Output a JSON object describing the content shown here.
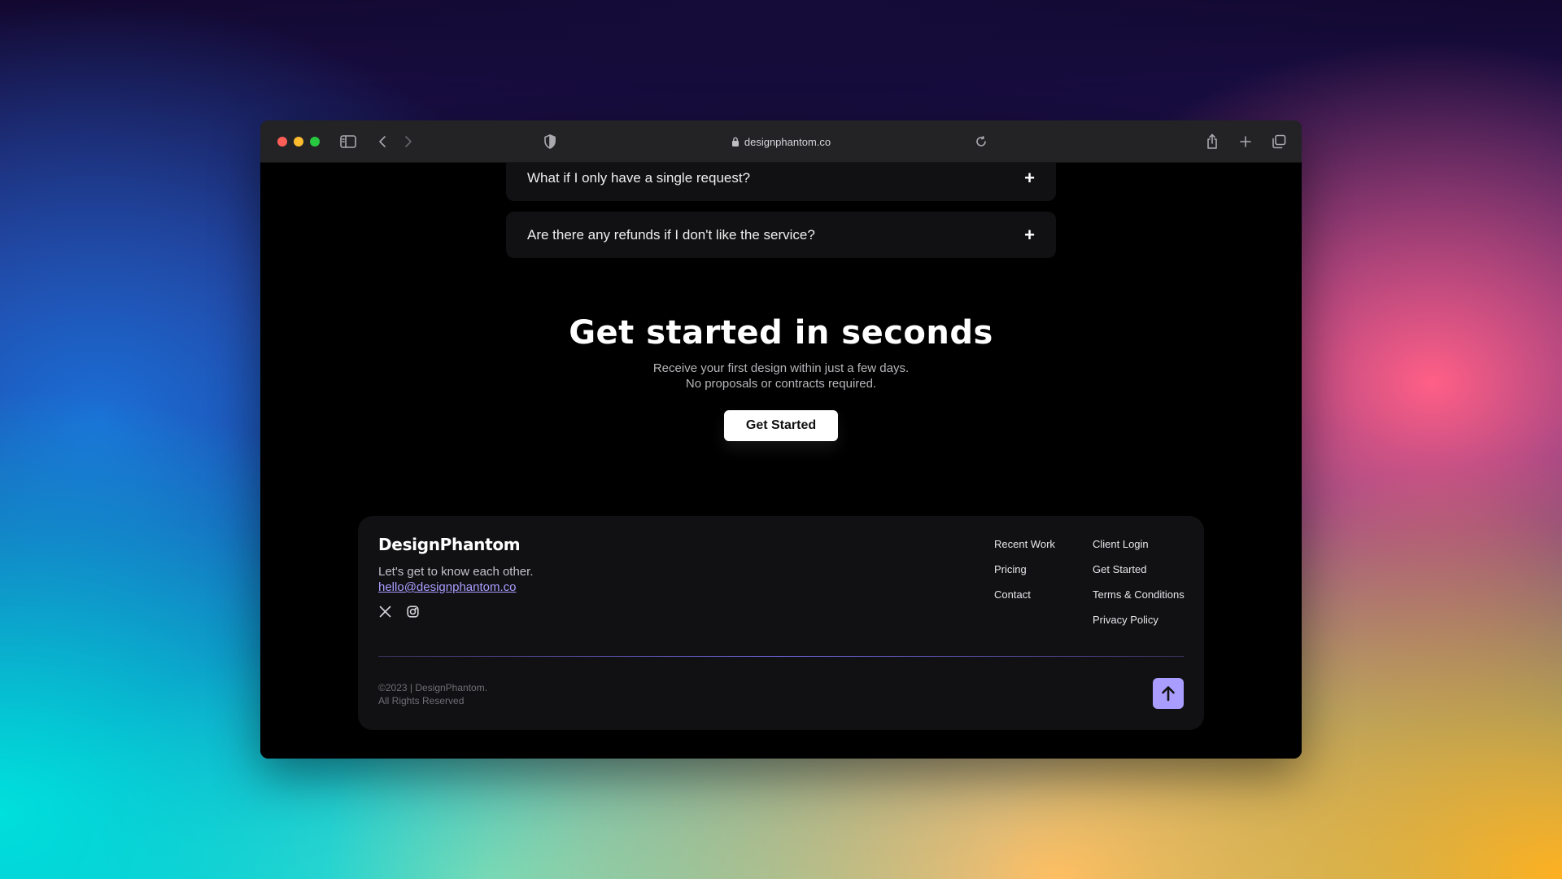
{
  "browser": {
    "url": "designphantom.co",
    "icons": [
      "sidebar-icon",
      "back-icon",
      "forward-icon",
      "shield-icon",
      "lock-icon",
      "reload-icon",
      "share-icon",
      "new-tab-icon",
      "tabs-overview-icon"
    ]
  },
  "faq": {
    "items": [
      {
        "question": "What if I only have a single request?",
        "toggle": "+"
      },
      {
        "question": "Are there any refunds if I don't like the service?",
        "toggle": "+"
      }
    ]
  },
  "hero": {
    "title": "Get started in seconds",
    "subtitle_line1": "Receive your first design within just a few days.",
    "subtitle_line2": "No proposals or contracts required.",
    "cta_label": "Get Started"
  },
  "footer": {
    "logo": "DesignPhantom",
    "tagline": "Let's get to know each other.",
    "email": "hello@designphantom.co",
    "social_icons": [
      "x-twitter-icon",
      "instagram-icon"
    ],
    "links_col1": [
      "Recent Work",
      "Pricing",
      "Contact"
    ],
    "links_col2": [
      "Client Login",
      "Get Started",
      "Terms & Conditions",
      "Privacy Policy"
    ],
    "copyright_line1": "©2023 | DesignPhantom.",
    "copyright_line2": "All Rights Reserved",
    "back_to_top_icon": "arrow-up-icon"
  },
  "colors": {
    "accent": "#a99dff",
    "page_background": "#000000",
    "card_background": "#111113"
  }
}
